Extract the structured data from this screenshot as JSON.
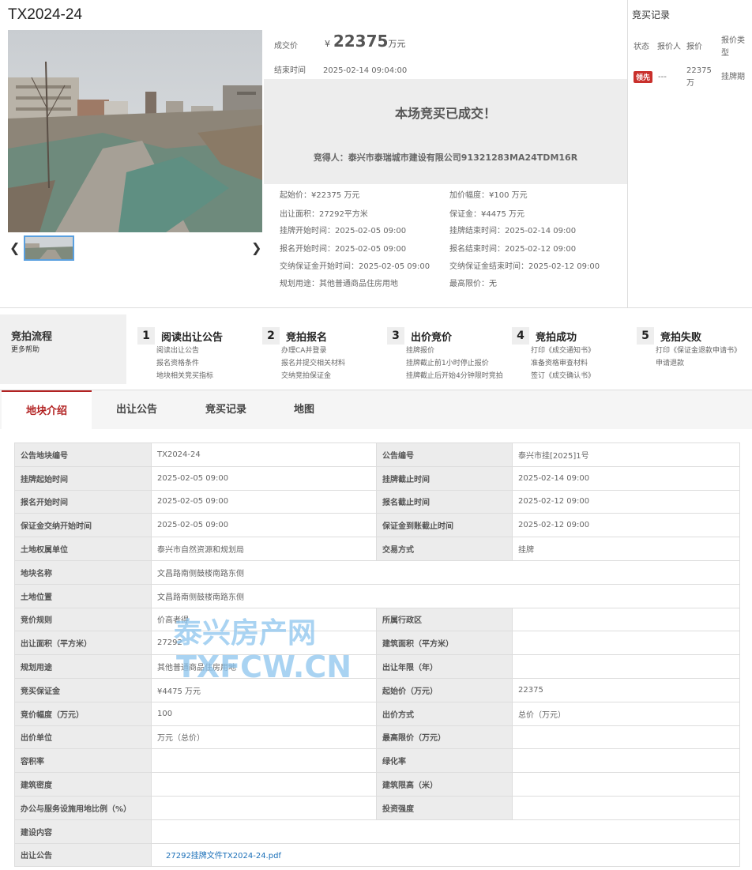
{
  "lot": {
    "title": "TX2024-24"
  },
  "deal": {
    "price_label": "成交价",
    "currency": "¥",
    "price": "22375",
    "unit": "万元",
    "end_label": "结束时间",
    "end_time": "2025-02-14 09:04:00",
    "done_title": "本场竞买已成交！",
    "winner": "竞得人：泰兴市泰瑞城市建设有限公司91321283MA24TDM16R"
  },
  "details": {
    "start_price": {
      "label": "起始价：",
      "value": "¥22375 万元"
    },
    "increment": {
      "label": "加价幅度：",
      "value": "¥100 万元"
    },
    "area": {
      "label": "出让面积：",
      "value": "27292平方米"
    },
    "deposit": {
      "label": "保证金：",
      "value": "¥4475 万元"
    },
    "listing_start": {
      "label": "挂牌开始时间：",
      "value": "2025-02-05 09:00"
    },
    "listing_end": {
      "label": "挂牌结束时间：",
      "value": "2025-02-14 09:00"
    },
    "signup_start": {
      "label": "报名开始时间：",
      "value": "2025-02-05 09:00"
    },
    "signup_end": {
      "label": "报名结束时间：",
      "value": "2025-02-12 09:00"
    },
    "deposit_start": {
      "label": "交纳保证金开始时间：",
      "value": "2025-02-05 09:00"
    },
    "deposit_end": {
      "label": "交纳保证金结束时间：",
      "value": "2025-02-12 09:00"
    },
    "usage": {
      "label": "规划用途：",
      "value": "其他普通商品住房用地"
    },
    "max_price": {
      "label": "最高限价：",
      "value": "无"
    }
  },
  "bid_record": {
    "title": "竞买记录",
    "headers": [
      "状态",
      "报价人",
      "报价",
      "报价类型"
    ],
    "row": {
      "status": "领先",
      "bidder": "---",
      "price": "22375万",
      "type": "挂牌期"
    }
  },
  "flow": {
    "title": "竞拍流程",
    "help": "更多帮助",
    "steps": [
      {
        "num": "1",
        "title": "阅读出让公告",
        "items": [
          "阅读出让公告",
          "报名资格条件",
          "地块相关竞买指标"
        ]
      },
      {
        "num": "2",
        "title": "竞拍报名",
        "items": [
          "办理CA并登录",
          "报名并提交相关材料",
          "交纳竞拍保证金"
        ]
      },
      {
        "num": "3",
        "title": "出价竞价",
        "items": [
          "挂牌报价",
          "挂牌截止前1小时停止报价",
          "挂牌截止后开始4分钟限时竞拍"
        ]
      },
      {
        "num": "4",
        "title": "竞拍成功",
        "items": [
          "打印《成交通知书》",
          "准备资格审查材料",
          "签订《成交确认书》"
        ]
      },
      {
        "num": "5",
        "title": "竞拍失败",
        "items": [
          "打印《保证金退款申请书》",
          "申请退款"
        ]
      }
    ]
  },
  "tabs": [
    "地块介绍",
    "出让公告",
    "竞买记录",
    "地图"
  ],
  "table": [
    [
      "公告地块编号",
      "TX2024-24",
      "公告编号",
      "泰兴市挂[2025]1号"
    ],
    [
      "挂牌起始时间",
      "2025-02-05 09:00",
      "挂牌截止时间",
      "2025-02-14 09:00"
    ],
    [
      "报名开始时间",
      "2025-02-05 09:00",
      "报名截止时间",
      "2025-02-12 09:00"
    ],
    [
      "保证金交纳开始时间",
      "2025-02-05 09:00",
      "保证金到账截止时间",
      "2025-02-12 09:00"
    ],
    [
      "土地权属单位",
      "泰兴市自然资源和规划局",
      "交易方式",
      "挂牌"
    ],
    [
      "地块名称",
      "文昌路南侧鼓楼南路东侧"
    ],
    [
      "土地位置",
      "文昌路南侧鼓楼南路东侧"
    ],
    [
      "竞价规则",
      "价高者得",
      "所属行政区",
      ""
    ],
    [
      "出让面积（平方米）",
      "27292",
      "建筑面积（平方米）",
      ""
    ],
    [
      "规划用途",
      "其他普通商品住房用地",
      "出让年限（年）",
      ""
    ],
    [
      "竞买保证金",
      "¥4475 万元",
      "起始价（万元）",
      "22375"
    ],
    [
      "竞价幅度（万元）",
      "100",
      "出价方式",
      "总价（万元）"
    ],
    [
      "出价单位",
      "万元（总价）",
      "最高限价（万元）",
      ""
    ],
    [
      "容积率",
      "",
      "绿化率",
      ""
    ],
    [
      "建筑密度",
      "",
      "建筑限高（米）",
      ""
    ],
    [
      "办公与服务设施用地比例（%）",
      "",
      "投资强度",
      ""
    ],
    [
      "建设内容",
      ""
    ],
    [
      "出让公告",
      "27292挂牌文件TX2024-24.pdf"
    ]
  ],
  "watermark": {
    "line1": "泰兴房产网",
    "line2": "TXFCW.CN"
  },
  "colors": {
    "accent": "#b22222",
    "badge": "#c9302c",
    "link": "#1a6fb8",
    "panel": "#ededed"
  }
}
